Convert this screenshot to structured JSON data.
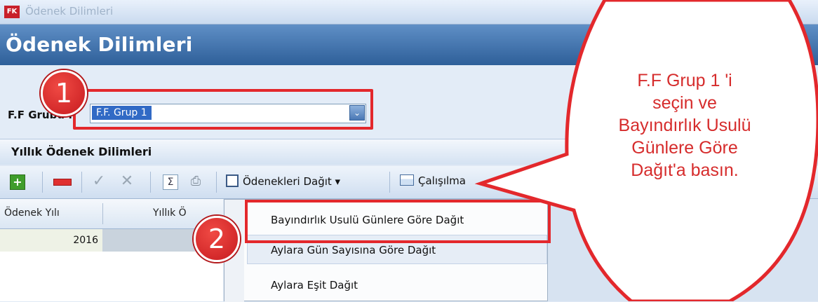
{
  "window": {
    "app_icon_text": "FK",
    "title": "Ödenek Dilimleri"
  },
  "header": {
    "page_title": "Ödenek Dilimleri"
  },
  "form": {
    "group_label": "F.F Grubu :",
    "group_value": "F.F. Grup 1"
  },
  "section": {
    "title": "Yıllık Ödenek Dilimleri"
  },
  "toolbar": {
    "add_icon": "plus-icon",
    "distribute_label": "Ödenekleri Dağıt ▾",
    "working_label": "Çalışılma"
  },
  "grid": {
    "columns": [
      "Ödenek Yılı",
      "Yıllık Ö"
    ],
    "rows": [
      {
        "year": "2016"
      }
    ]
  },
  "menu": {
    "items": [
      "Bayındırlık Usulü Günlere Göre Dağıt",
      "Aylara Gün Sayısına Göre Dağıt",
      "Aylara Eşit Dağıt"
    ]
  },
  "annotations": {
    "step1": "1",
    "step2": "2",
    "callout_lines": [
      "F.F Grup 1 'i",
      "seçin ve",
      "Bayındırlık Usulü",
      "Günlere Göre",
      "Dağıt'a basın."
    ],
    "accent_color": "#e3282c"
  }
}
